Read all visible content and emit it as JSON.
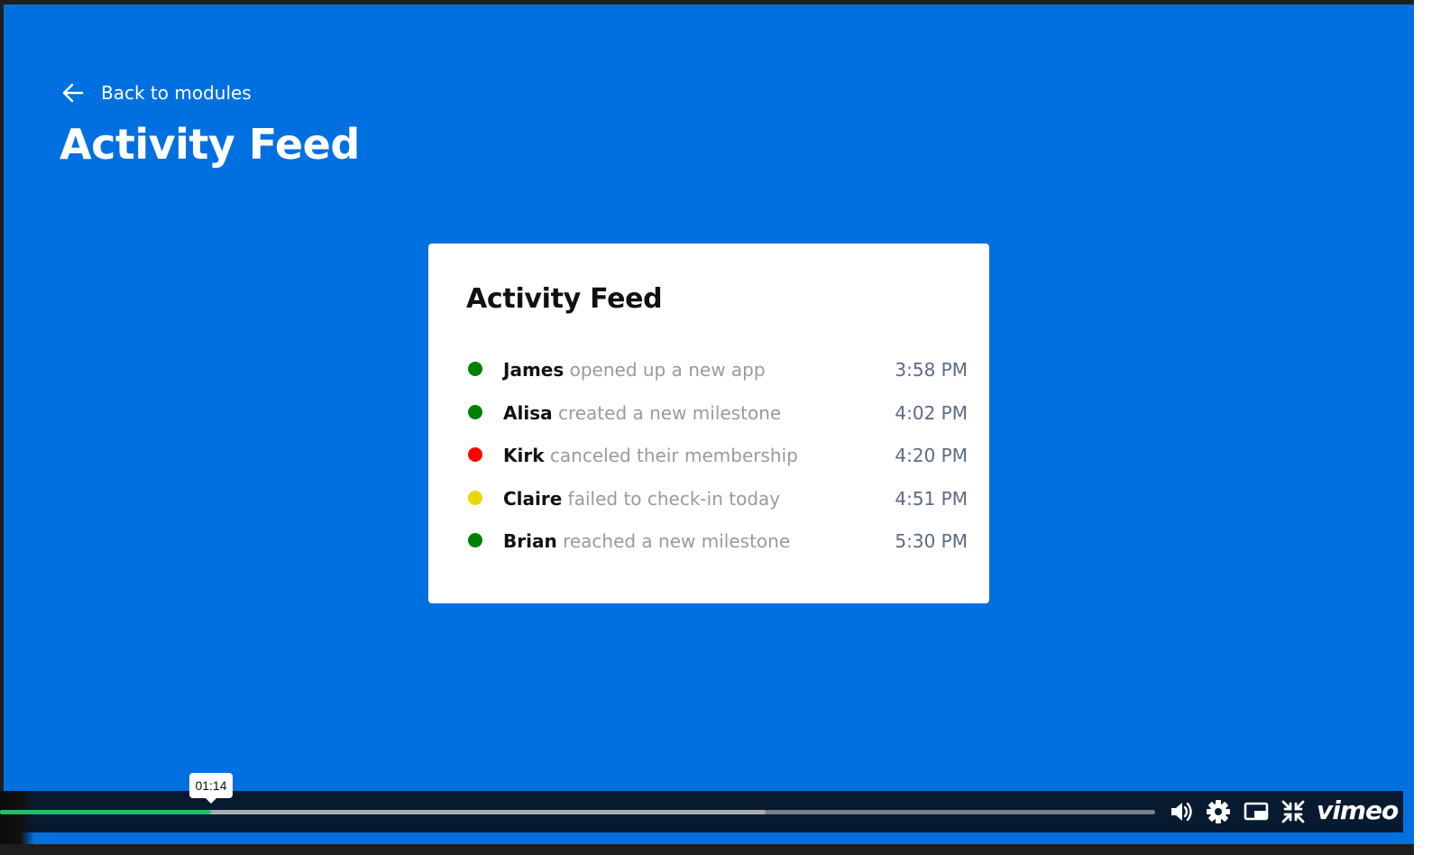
{
  "nav": {
    "back_label": "Back to modules"
  },
  "page": {
    "title": "Activity Feed",
    "background_color": "#0070e0"
  },
  "card": {
    "title": "Activity Feed",
    "items": [
      {
        "name": "James",
        "action": "opened up a new app",
        "time": "3:58 PM",
        "status_color": "#008000"
      },
      {
        "name": "Alisa",
        "action": "created a new milestone",
        "time": "4:02 PM",
        "status_color": "#008000"
      },
      {
        "name": "Kirk",
        "action": "canceled their membership",
        "time": "4:20 PM",
        "status_color": "#ff0000"
      },
      {
        "name": "Claire",
        "action": "failed to check-in today",
        "time": "4:51 PM",
        "status_color": "#e6d800"
      },
      {
        "name": "Brian",
        "action": "reached a new milestone",
        "time": "5:30 PM",
        "status_color": "#008000"
      }
    ]
  },
  "player": {
    "hover_time": "01:14",
    "played_fraction": 0.183,
    "buffered_fraction": 0.663,
    "played_color": "#1fbf6a",
    "controls": [
      "volume-icon",
      "settings-icon",
      "picture-in-picture-icon",
      "exit-fullscreen-icon"
    ],
    "brand": "vimeo"
  }
}
